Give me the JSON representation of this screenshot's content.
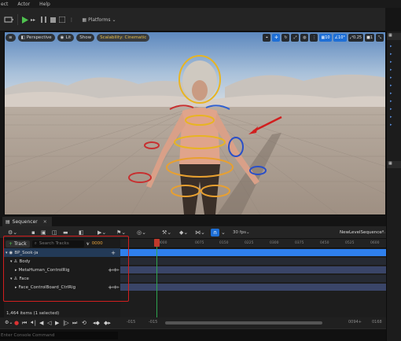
{
  "menu": [
    "ect",
    "Actor",
    "Help"
  ],
  "viewport": {
    "view_mode": "Perspective",
    "lit": "Lit",
    "show": "Show",
    "scalability": "Scalability: Cinematic",
    "grid_snap": "10",
    "rot_snap": "10°",
    "scale_snap": "0.25",
    "cam_speed": "1"
  },
  "toolbar": {
    "platforms": "Platforms"
  },
  "sequencer": {
    "tab": "Sequencer",
    "fps": "30 fps",
    "sequence_name": "NewLevelSequence*",
    "track_button": "Track",
    "search_placeholder": "Search Tracks",
    "current_frame": "0000",
    "tree": [
      {
        "label": "BP_Sook-ja",
        "depth": 0
      },
      {
        "label": "Body",
        "depth": 1
      },
      {
        "label": "MetaHuman_ControlRig",
        "depth": 2
      },
      {
        "label": "Face",
        "depth": 1
      },
      {
        "label": "Face_ControlBoard_CtrlRig",
        "depth": 2
      }
    ],
    "ruler_ticks": [
      "0000",
      "0075",
      "0150",
      "0225",
      "0300",
      "0375",
      "0450",
      "0525",
      "0600",
      "0675"
    ],
    "status": "1,464 items (1 selected)",
    "bottom_left_1": "-015",
    "bottom_left_2": "-015",
    "bottom_right_1": "0094+",
    "bottom_right_2": "0168"
  },
  "console": {
    "placeholder": "Enter Console Command"
  },
  "colors": {
    "accent": "#1e6fd6",
    "track_bar": "#2f80ed",
    "highlight": "#d11f1f",
    "playhead": "#2ea44f"
  }
}
